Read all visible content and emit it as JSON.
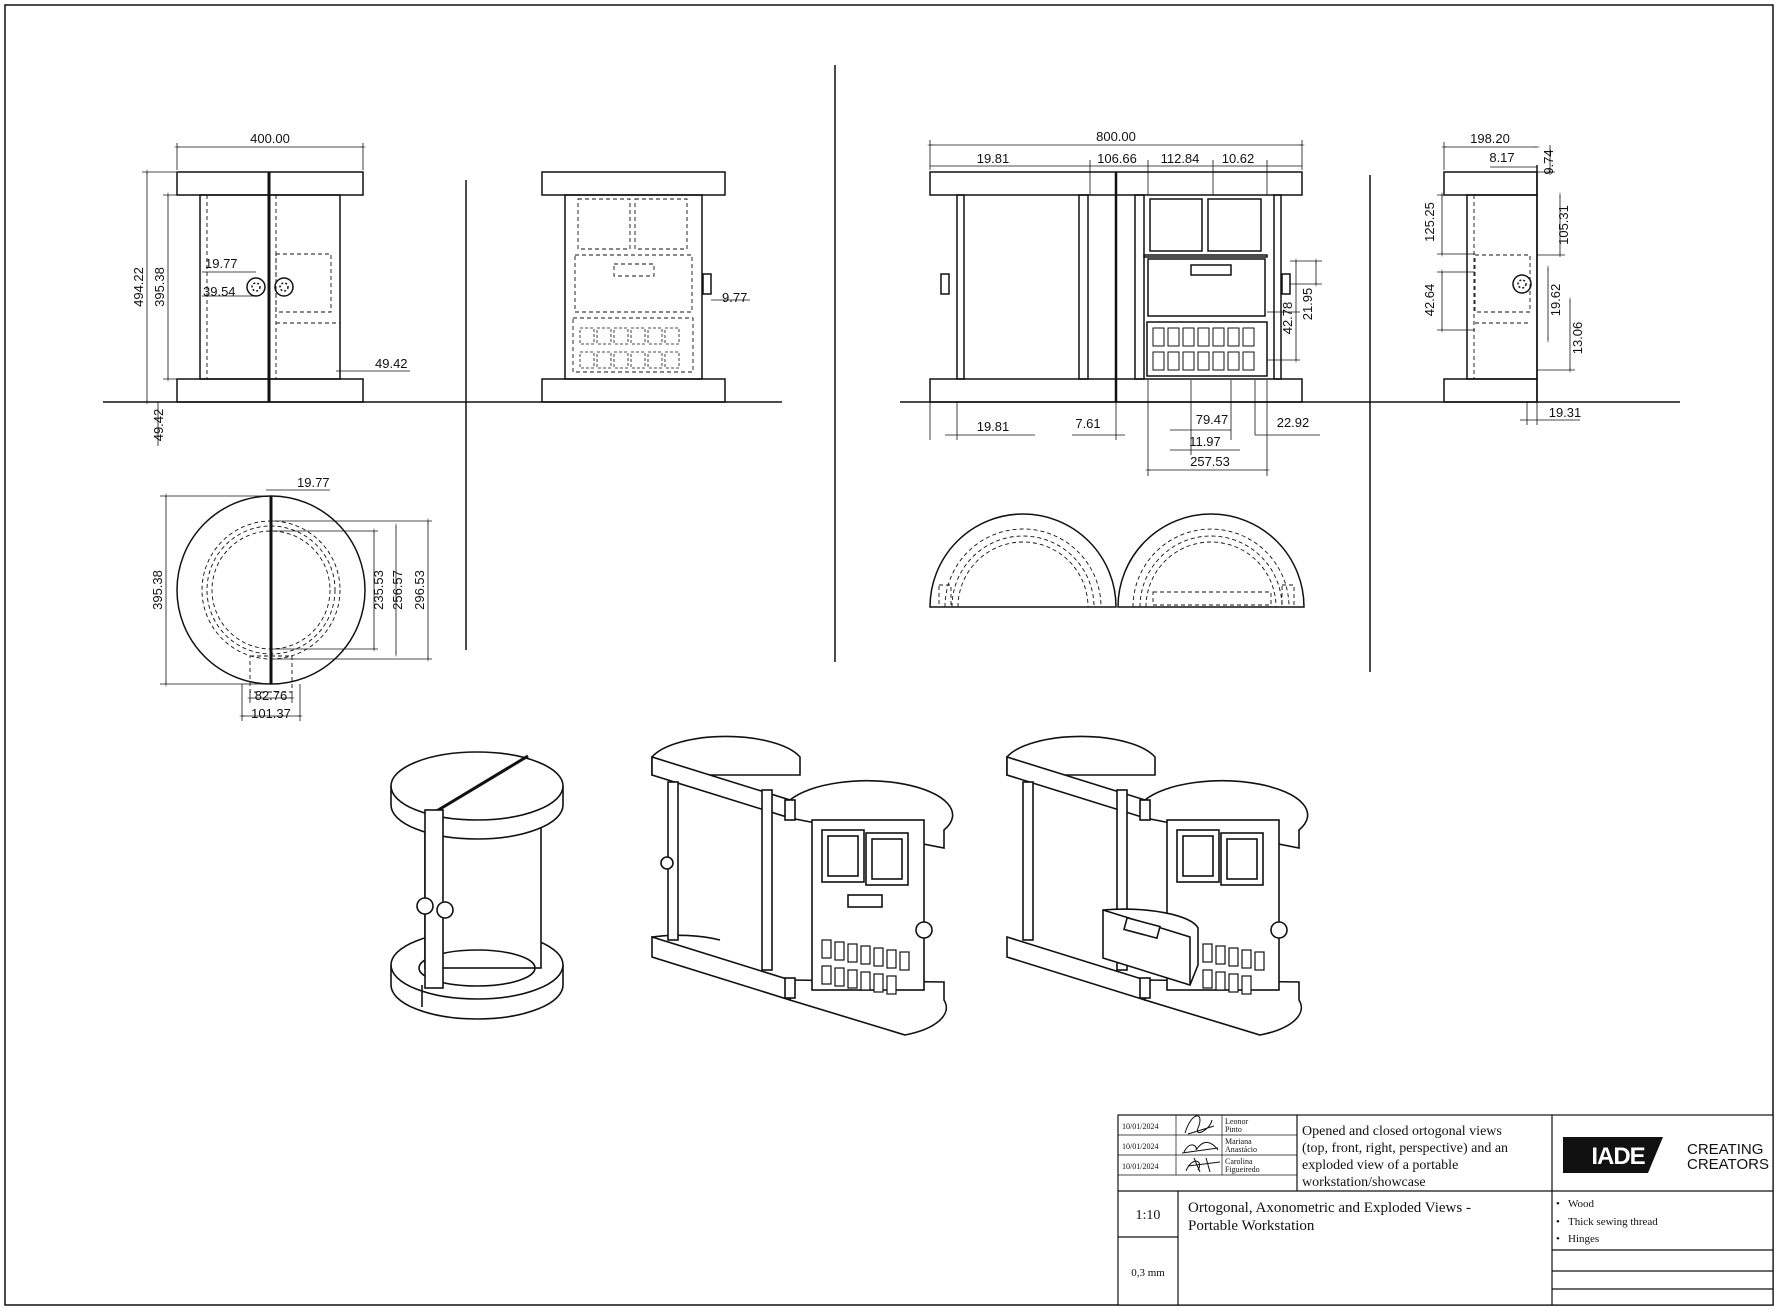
{
  "dimensions": {
    "closed_front": {
      "width": "400.00",
      "height": "494.22",
      "inner_height": "395.38",
      "offset_a": "19.77",
      "offset_b": "39.54",
      "base": "49.42",
      "base_left": "49.42"
    },
    "closed_right": {
      "handle": "9.77"
    },
    "closed_top": {
      "seam": "19.77",
      "diameter": "395.38",
      "d1": "235.53",
      "d2": "256.57",
      "d3": "296.53",
      "w1": "82.76",
      "w2": "101.37"
    },
    "open_front": {
      "width": "800.00",
      "t1": "19.81",
      "t2": "106.66",
      "t3": "112.84",
      "t4": "10.62",
      "b1": "19.81",
      "b2": "7.61",
      "b3": "79.47",
      "b4": "11.97",
      "b5": "22.92",
      "b6": "257.53",
      "v1": "42.78",
      "v2": "21.95"
    },
    "open_right": {
      "width": "198.20",
      "a": "8.17",
      "b": "9.74",
      "c": "125.25",
      "d": "105.31",
      "e": "42.64",
      "f": "19.62",
      "g": "13.06",
      "h": "19.31"
    }
  },
  "title_block": {
    "dates": [
      "10/01/2024",
      "10/01/2024",
      "10/01/2024"
    ],
    "authors": [
      {
        "first": "Leonor",
        "last": "Pinto"
      },
      {
        "first": "Mariana",
        "last": "Anastácio"
      },
      {
        "first": "Carolina",
        "last": "Figueiredo"
      }
    ],
    "description": [
      "Opened and closed ortogonal views",
      "(top, front, right, perspective) and an",
      "exploded view of a portable",
      "workstation/showcase"
    ],
    "logo_text": "IADE",
    "tagline": [
      "CREATING",
      "CREATORS"
    ],
    "scale": "1:10",
    "line_weight": "0,3 mm",
    "title": [
      "Ortogonal, Axonometric and Exploded Views -",
      "Portable Workstation"
    ],
    "materials": [
      "Wood",
      "Thick sewing thread",
      "Hinges"
    ]
  }
}
